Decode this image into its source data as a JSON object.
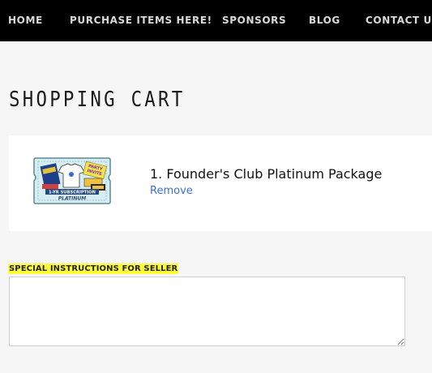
{
  "nav": {
    "items": [
      {
        "label": "HOME"
      },
      {
        "label": "PURCHASE ITEMS HERE!"
      },
      {
        "label": "SPONSORS"
      },
      {
        "label": "BLOG"
      },
      {
        "label": "CONTACT US"
      }
    ]
  },
  "page": {
    "title": "SHOPPING CART"
  },
  "cart": {
    "items": [
      {
        "name": "1. Founder's Club Platinum Package",
        "remove_label": "Remove",
        "thumbnail": {
          "banner_text": "1-YR SUBSCRIPTION",
          "tier_text": "PLATINUM",
          "badge_text_1": "PARTY",
          "badge_text_2": "INVITE"
        }
      }
    ]
  },
  "instructions": {
    "label": "SPECIAL INSTRUCTIONS FOR SELLER",
    "value": ""
  },
  "colors": {
    "nav_bg": "#000000",
    "link": "#3b6fd6",
    "highlight": "#ffff3a",
    "page_bg": "#f6f6f6"
  }
}
